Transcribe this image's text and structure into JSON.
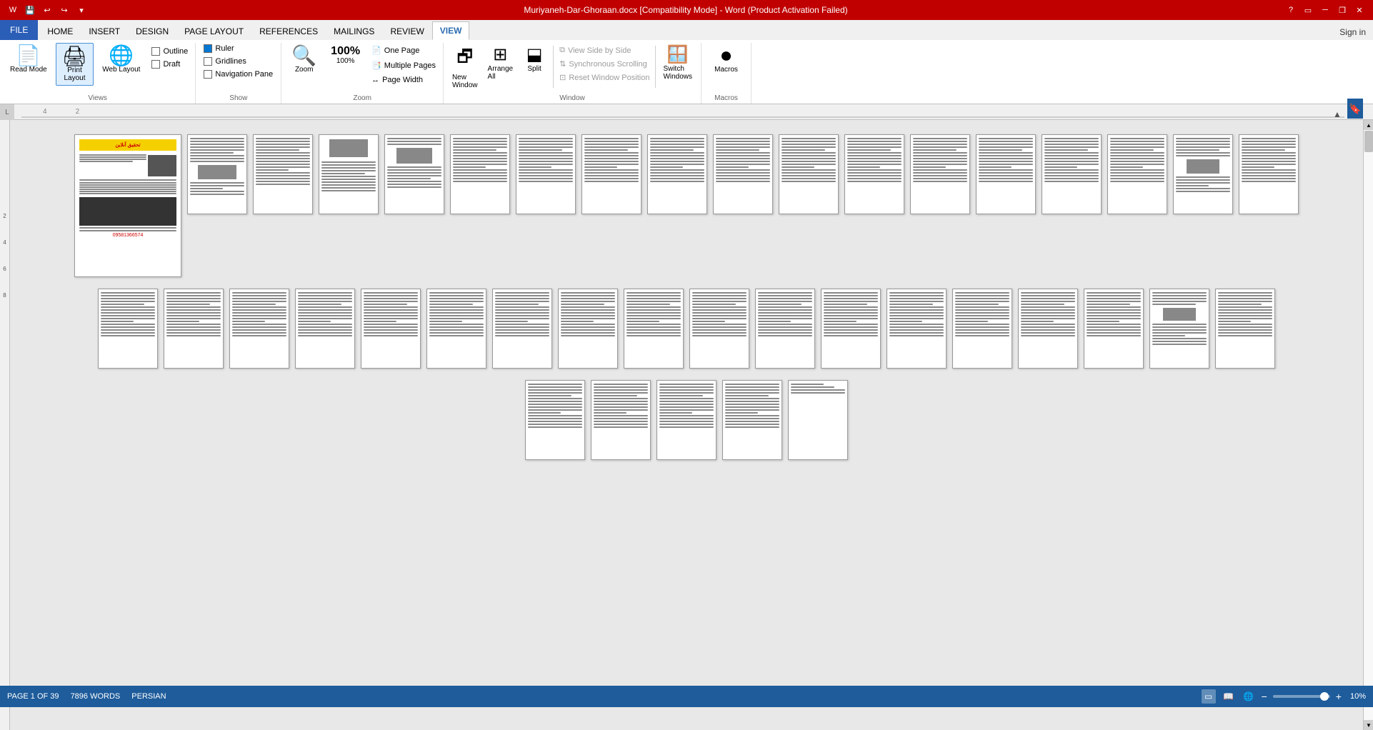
{
  "titleBar": {
    "title": "Muriyaneh-Dar-Ghoraan.docx [Compatibility Mode] - Word (Product Activation Failed)",
    "bgColor": "#c00000",
    "quickAccess": [
      "save",
      "undo",
      "redo",
      "customize"
    ],
    "winControls": [
      "help",
      "ribbon-display",
      "minimize",
      "restore",
      "close"
    ]
  },
  "ribbon": {
    "tabs": [
      {
        "id": "file",
        "label": "FILE",
        "isFile": true
      },
      {
        "id": "home",
        "label": "HOME"
      },
      {
        "id": "insert",
        "label": "INSERT"
      },
      {
        "id": "design",
        "label": "DESIGN"
      },
      {
        "id": "pageLayout",
        "label": "PAGE LAYOUT"
      },
      {
        "id": "references",
        "label": "REFERENCES"
      },
      {
        "id": "mailings",
        "label": "MAILINGS"
      },
      {
        "id": "review",
        "label": "REVIEW"
      },
      {
        "id": "view",
        "label": "VIEW",
        "active": true
      }
    ],
    "signin": "Sign in",
    "groups": {
      "views": {
        "label": "Views",
        "buttons": [
          {
            "id": "readMode",
            "label": "Read\nMode",
            "icon": "📄"
          },
          {
            "id": "printLayout",
            "label": "Print\nLayout",
            "icon": "🖨",
            "active": true
          },
          {
            "id": "webLayout",
            "label": "Web\nLayout",
            "icon": "🌐"
          }
        ],
        "subButtons": [
          {
            "id": "outline",
            "label": "Outline",
            "checked": false
          },
          {
            "id": "draft",
            "label": "Draft",
            "checked": false
          }
        ]
      },
      "show": {
        "label": "Show",
        "items": [
          {
            "id": "ruler",
            "label": "Ruler",
            "checked": true
          },
          {
            "id": "gridlines",
            "label": "Gridlines",
            "checked": false
          },
          {
            "id": "navPane",
            "label": "Navigation Pane",
            "checked": false
          }
        ]
      },
      "zoom": {
        "label": "Zoom",
        "buttons": [
          {
            "id": "zoom",
            "label": "Zoom",
            "icon": "🔍"
          },
          {
            "id": "100pct",
            "label": "100%",
            "icon": "1:1"
          }
        ],
        "subButtons": [
          {
            "id": "onePage",
            "label": "One Page",
            "icon": "📄"
          },
          {
            "id": "multiplePages",
            "label": "Multiple Pages",
            "icon": "📑"
          },
          {
            "id": "pageWidth",
            "label": "Page Width",
            "icon": "↔"
          }
        ]
      },
      "window": {
        "label": "Window",
        "buttons": [
          {
            "id": "newWindow",
            "label": "New\nWindow",
            "icon": "🗗"
          },
          {
            "id": "arrangeAll",
            "label": "Arrange\nAll",
            "icon": "⊞"
          },
          {
            "id": "split",
            "label": "Split",
            "icon": "⬓"
          },
          {
            "id": "switchWindows",
            "label": "Switch\nWindows",
            "icon": "🪟"
          }
        ],
        "disabledButtons": [
          {
            "id": "viewSideBySide",
            "label": "View Side by Side"
          },
          {
            "id": "syncScrolling",
            "label": "Synchronous Scrolling"
          },
          {
            "id": "resetWindow",
            "label": "Reset Window Position"
          }
        ]
      },
      "macros": {
        "label": "Macros",
        "buttons": [
          {
            "id": "macros",
            "label": "Macros",
            "icon": "⏺"
          }
        ]
      }
    }
  },
  "ruler": {
    "markers": [
      "L",
      "4",
      "2"
    ]
  },
  "leftRuler": {
    "markers": [
      "2",
      "4",
      "6",
      "8"
    ]
  },
  "document": {
    "rows": [
      {
        "pages": 18,
        "hasFirstSpecial": true
      },
      {
        "pages": 18,
        "hasFirstSpecial": false
      },
      {
        "pages": 5,
        "hasFirstSpecial": false
      }
    ]
  },
  "statusBar": {
    "pageInfo": "PAGE 1 OF 39",
    "wordCount": "7896 WORDS",
    "language": "PERSIAN",
    "viewButtons": [
      {
        "id": "print-view",
        "label": "🖨",
        "active": true
      },
      {
        "id": "read-view",
        "label": "📖",
        "active": false
      },
      {
        "id": "web-view",
        "label": "🌐",
        "active": false
      }
    ],
    "zoom": "10%",
    "zoomValue": 10
  },
  "bookmark": {
    "icon": "🔖"
  }
}
